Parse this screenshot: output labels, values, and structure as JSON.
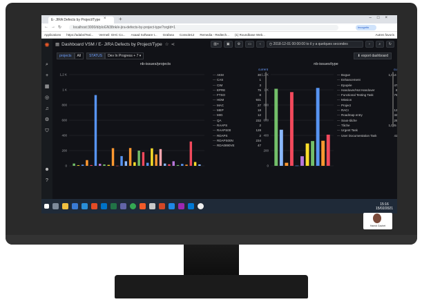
{
  "browser": {
    "tab_title": "E- JIRA Defects by Project/Type",
    "url": "localhost:3000/d/pIoGN38nk/e-jira-defects-by-project-type?orgId=1",
    "profile": "Incognito",
    "bookmarks": [
      "Applications",
      "https://adabs/Teal...",
      "Vermeil: GHC Co...",
      "Asaad Software t...",
      "Grafana",
      "Console12",
      "Remedia - Redtech...",
      "(1) Roundbase Web..."
    ],
    "bookmarks_right": "Autres favoris"
  },
  "grafana": {
    "breadcrumb": "Dashboard VSM / E- JIRA Defects by Project/Type",
    "time_range": "2018-12-01 00:00:00 to il y a quelques secondes",
    "export_label": "export dashboard",
    "vars": [
      {
        "label": "projects",
        "value": "All"
      },
      {
        "label": "STATUS",
        "value": "Dev In Progress + 7 ▾"
      }
    ]
  },
  "panel1": {
    "title": "nb-issues/projects",
    "legend_header": "current",
    "legend": [
      {
        "name": "AKM",
        "value": "30"
      },
      {
        "name": "CAS",
        "value": "1"
      },
      {
        "name": "CIM",
        "value": "3"
      },
      {
        "name": "EPRE",
        "value": "75"
      },
      {
        "name": "FTSO",
        "value": "8"
      },
      {
        "name": "HDM",
        "value": "931"
      },
      {
        "name": "MAC",
        "value": "27"
      },
      {
        "name": "MEP",
        "value": "18"
      },
      {
        "name": "MIG",
        "value": "12"
      },
      {
        "name": "QA",
        "value": "232"
      },
      {
        "name": "RAAPS",
        "value": "2"
      },
      {
        "name": "RAAPS00",
        "value": "128"
      },
      {
        "name": "RDAPS",
        "value": "2"
      },
      {
        "name": "RDAPS00N",
        "value": "234"
      },
      {
        "name": "RDA0890VE",
        "value": "47"
      }
    ]
  },
  "panel2": {
    "title": "nb-issues/type",
    "legend_header": "current",
    "legend": [
      {
        "name": "Bogue",
        "value": "1,014 K"
      },
      {
        "name": "Enhancement",
        "value": "1"
      },
      {
        "name": "Epopée",
        "value": "475"
      },
      {
        "name": "Handover/Hot Handover",
        "value": "84"
      },
      {
        "name": "Functional Testing Task",
        "value": "754"
      },
      {
        "name": "Mission",
        "value": "3"
      },
      {
        "name": "Project",
        "value": "1"
      },
      {
        "name": "RACI",
        "value": "126"
      },
      {
        "name": "Roadmap entry",
        "value": "326"
      },
      {
        "name": "Sous-tâche",
        "value": "294"
      },
      {
        "name": "Tâche",
        "value": "1,025 K"
      },
      {
        "name": "Urgent Task",
        "value": "1"
      },
      {
        "name": "User Documentation Task",
        "value": "410"
      }
    ]
  },
  "chart_data": [
    {
      "type": "bar",
      "title": "nb-issues/projects",
      "ylim": [
        0,
        1200
      ],
      "yticks": [
        "1,2 K",
        "1 K",
        "800",
        "600",
        "400",
        "200",
        "0"
      ],
      "bars": [
        {
          "color": "#73bf69",
          "value": 30
        },
        {
          "color": "#fade2a",
          "value": 8
        },
        {
          "color": "#5794f2",
          "value": 15
        },
        {
          "color": "#ff9830",
          "value": 75
        },
        {
          "color": "#f2495c",
          "value": 10
        },
        {
          "color": "#5794f2",
          "value": 931
        },
        {
          "color": "#b877d9",
          "value": 27
        },
        {
          "color": "#73bf69",
          "value": 18
        },
        {
          "color": "#fade2a",
          "value": 12
        },
        {
          "color": "#ff9830",
          "value": 232
        },
        {
          "color": "#f2495c",
          "value": 2
        },
        {
          "color": "#5794f2",
          "value": 128
        },
        {
          "color": "#8ab8ff",
          "value": 60
        },
        {
          "color": "#ff9830",
          "value": 234
        },
        {
          "color": "#fade2a",
          "value": 47
        },
        {
          "color": "#73bf69",
          "value": 200
        },
        {
          "color": "#f2495c",
          "value": 180
        },
        {
          "color": "#5794f2",
          "value": 40
        },
        {
          "color": "#fade2a",
          "value": 230
        },
        {
          "color": "#ff9830",
          "value": 150
        },
        {
          "color": "#ffa6b0",
          "value": 220
        },
        {
          "color": "#8ab8ff",
          "value": 30
        },
        {
          "color": "#f2495c",
          "value": 20
        },
        {
          "color": "#b877d9",
          "value": 60
        },
        {
          "color": "#73bf69",
          "value": 10
        },
        {
          "color": "#5794f2",
          "value": 25
        },
        {
          "color": "#ff9830",
          "value": 15
        },
        {
          "color": "#f2495c",
          "value": 320
        },
        {
          "color": "#fade2a",
          "value": 50
        },
        {
          "color": "#8ab8ff",
          "value": 18
        }
      ]
    },
    {
      "type": "bar",
      "title": "nb-issues/type",
      "ylim": [
        0,
        1200
      ],
      "yticks": [
        "1,2 K",
        "1 K",
        "800",
        "600",
        "400",
        "200",
        "0"
      ],
      "bars": [
        {
          "color": "#73bf69",
          "value": 1014
        },
        {
          "color": "#8ab8ff",
          "value": 475
        },
        {
          "color": "#ff9830",
          "value": 40
        },
        {
          "color": "#f2495c",
          "value": 970
        },
        {
          "color": "#5794f2",
          "value": 3
        },
        {
          "color": "#b877d9",
          "value": 126
        },
        {
          "color": "#fade2a",
          "value": 294
        },
        {
          "color": "#73bf69",
          "value": 326
        },
        {
          "color": "#5794f2",
          "value": 1025
        },
        {
          "color": "#ff9830",
          "value": 330
        },
        {
          "color": "#f2495c",
          "value": 410
        }
      ]
    }
  ],
  "taskbar": {
    "time": "15:16",
    "date": "15/02/2021"
  },
  "webcam": {
    "label": "Hamdi Gachet"
  }
}
